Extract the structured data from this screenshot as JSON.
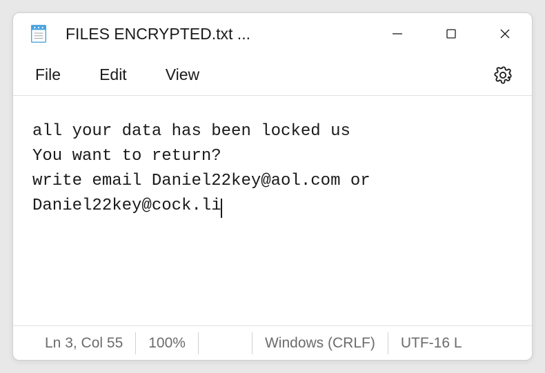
{
  "window": {
    "title": "FILES ENCRYPTED.txt ..."
  },
  "menu": {
    "file": "File",
    "edit": "Edit",
    "view": "View"
  },
  "content": {
    "line1": "all your data has been locked us",
    "line2": "You want to return?",
    "line3": "write email Daniel22key@aol.com or Daniel22key@cock.li"
  },
  "status": {
    "position": "Ln 3, Col 55",
    "zoom": "100%",
    "line_ending": "Windows (CRLF)",
    "encoding": "UTF-16 L"
  }
}
